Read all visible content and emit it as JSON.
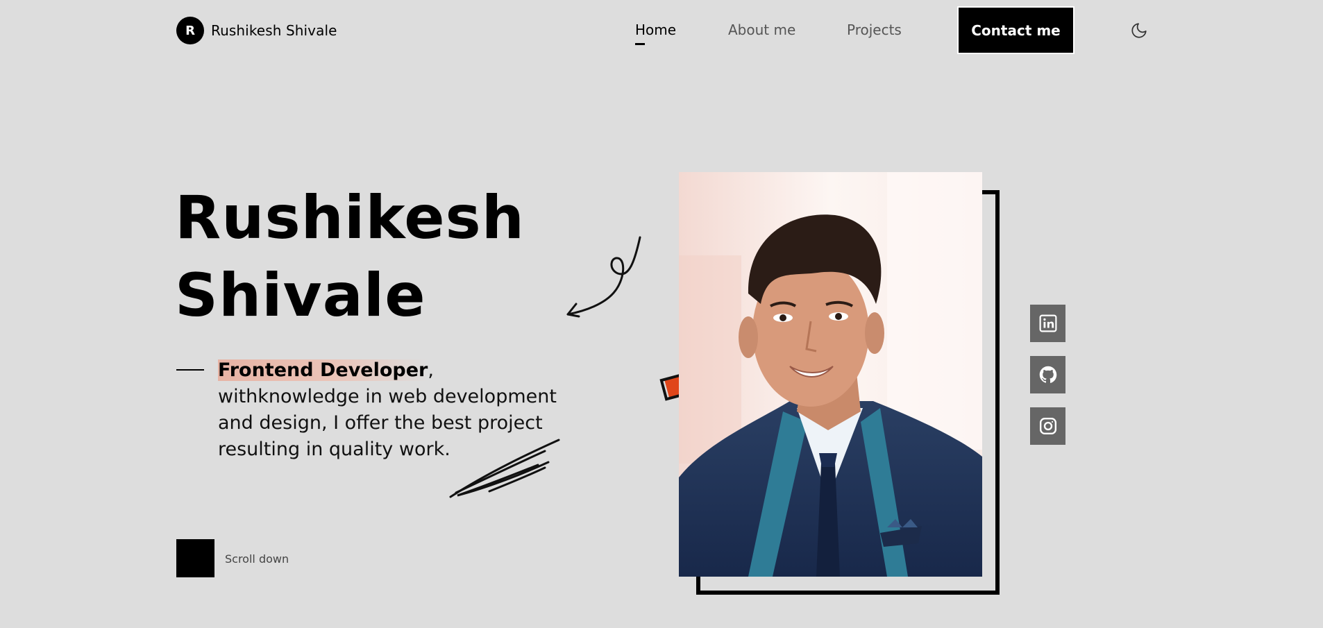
{
  "header": {
    "logo_initial": "R",
    "logo_name": "Rushikesh Shivale",
    "nav": [
      {
        "label": "Home"
      },
      {
        "label": "About me"
      },
      {
        "label": "Projects"
      }
    ],
    "contact_label": "Contact me",
    "theme_icon": "moon-icon"
  },
  "hero": {
    "title_line1": "Rushikesh",
    "title_line2": "Shivale",
    "role_highlight": "Frontend Developer",
    "description_rest": ", withknowledge in web development and design, I offer the best project resulting in quality work.",
    "scroll_label": "Scroll down"
  },
  "socials": [
    {
      "icon": "linkedin-icon"
    },
    {
      "icon": "github-icon"
    },
    {
      "icon": "instagram-icon"
    }
  ],
  "colors": {
    "background": "#dddddd",
    "accent": "#e0461a",
    "highlight": "#e7b3a4",
    "social_bg": "#666666"
  }
}
